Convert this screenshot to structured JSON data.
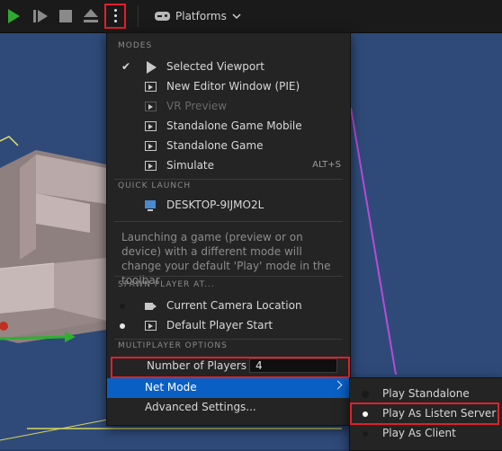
{
  "toolbar": {
    "platforms_label": "Platforms"
  },
  "menu": {
    "modes_header": "MODES",
    "modes": [
      {
        "label": "Selected Viewport",
        "checked": true,
        "icon": "play-icon"
      },
      {
        "label": "New Editor Window (PIE)",
        "icon": "window-play-icon"
      },
      {
        "label": "VR Preview",
        "disabled": true,
        "icon": "vr-icon"
      },
      {
        "label": "Standalone Game Mobile",
        "icon": "mobile-play-icon"
      },
      {
        "label": "Standalone Game",
        "icon": "standalone-play-icon"
      },
      {
        "label": "Simulate",
        "shortcut": "ALT+S",
        "icon": "simulate-icon"
      }
    ],
    "quick_launch_header": "QUICK LAUNCH",
    "quick_launch_device": "DESKTOP-9IJMO2L",
    "info_text": "Launching a game (preview or on device) with a different mode will change your default 'Play' mode in the toolbar",
    "spawn_header": "SPAWN PLAYER AT...",
    "spawn_options": [
      {
        "label": "Current Camera Location",
        "selected": false
      },
      {
        "label": "Default Player Start",
        "selected": true
      }
    ],
    "multiplayer_header": "MULTIPLAYER OPTIONS",
    "number_of_players_label": "Number of Players",
    "number_of_players_value": "4",
    "net_mode_label": "Net Mode",
    "advanced_settings_label": "Advanced Settings..."
  },
  "net_mode_submenu": [
    {
      "label": "Play Standalone",
      "selected": false
    },
    {
      "label": "Play As Listen Server",
      "selected": true
    },
    {
      "label": "Play As Client",
      "selected": false
    }
  ],
  "colors": {
    "accent": "#0a5fc4",
    "highlight_box": "#e0202a",
    "play_green": "#2faa2f"
  }
}
